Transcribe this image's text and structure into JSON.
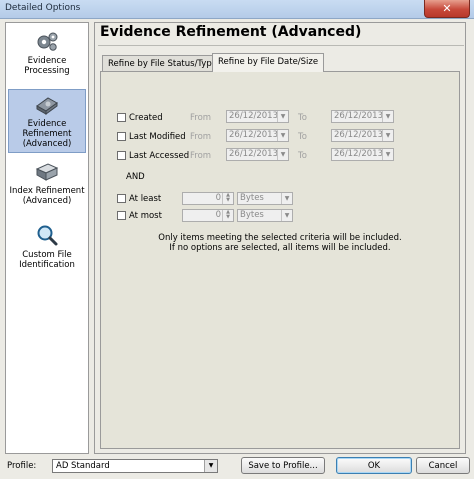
{
  "window": {
    "title": "Detailed Options",
    "close_glyph": "✕"
  },
  "sidebar": {
    "items": [
      {
        "label": "Evidence Processing",
        "icon": "gears-icon"
      },
      {
        "label": "Evidence Refinement (Advanced)",
        "icon": "drive-icon"
      },
      {
        "label": "Index Refinement (Advanced)",
        "icon": "book-icon"
      },
      {
        "label": "Custom File Identification",
        "icon": "magnifier-icon"
      }
    ],
    "active_index": 1
  },
  "main": {
    "heading": "Evidence Refinement (Advanced)",
    "tabs": [
      {
        "label": "Refine by File Status/Type"
      },
      {
        "label": "Refine by File Date/Size"
      }
    ],
    "selected_tab": 1,
    "date_rows": [
      {
        "label": "Created",
        "from_label": "From",
        "from": "26/12/2013",
        "to_label": "To",
        "to": "26/12/2013"
      },
      {
        "label": "Last Modified",
        "from_label": "From",
        "from": "26/12/2013",
        "to_label": "To",
        "to": "26/12/2013"
      },
      {
        "label": "Last Accessed",
        "from_label": "From",
        "from": "26/12/2013",
        "to_label": "To",
        "to": "26/12/2013"
      }
    ],
    "and_label": "AND",
    "size_rows": [
      {
        "label": "At least",
        "value": "0",
        "unit": "Bytes"
      },
      {
        "label": "At most",
        "value": "0",
        "unit": "Bytes"
      }
    ],
    "note_line1": "Only items meeting the selected criteria will be included.",
    "note_line2": "If no options are selected, all items will be included."
  },
  "footer": {
    "profile_label": "Profile:",
    "profile_value": "AD Standard",
    "save_label": "Save to Profile...",
    "ok_label": "OK",
    "cancel_label": "Cancel"
  },
  "colors": {
    "active_item": "#b9cbe8",
    "panel_bg": "#e5e4d9",
    "ok_border": "#3c7fb1"
  }
}
